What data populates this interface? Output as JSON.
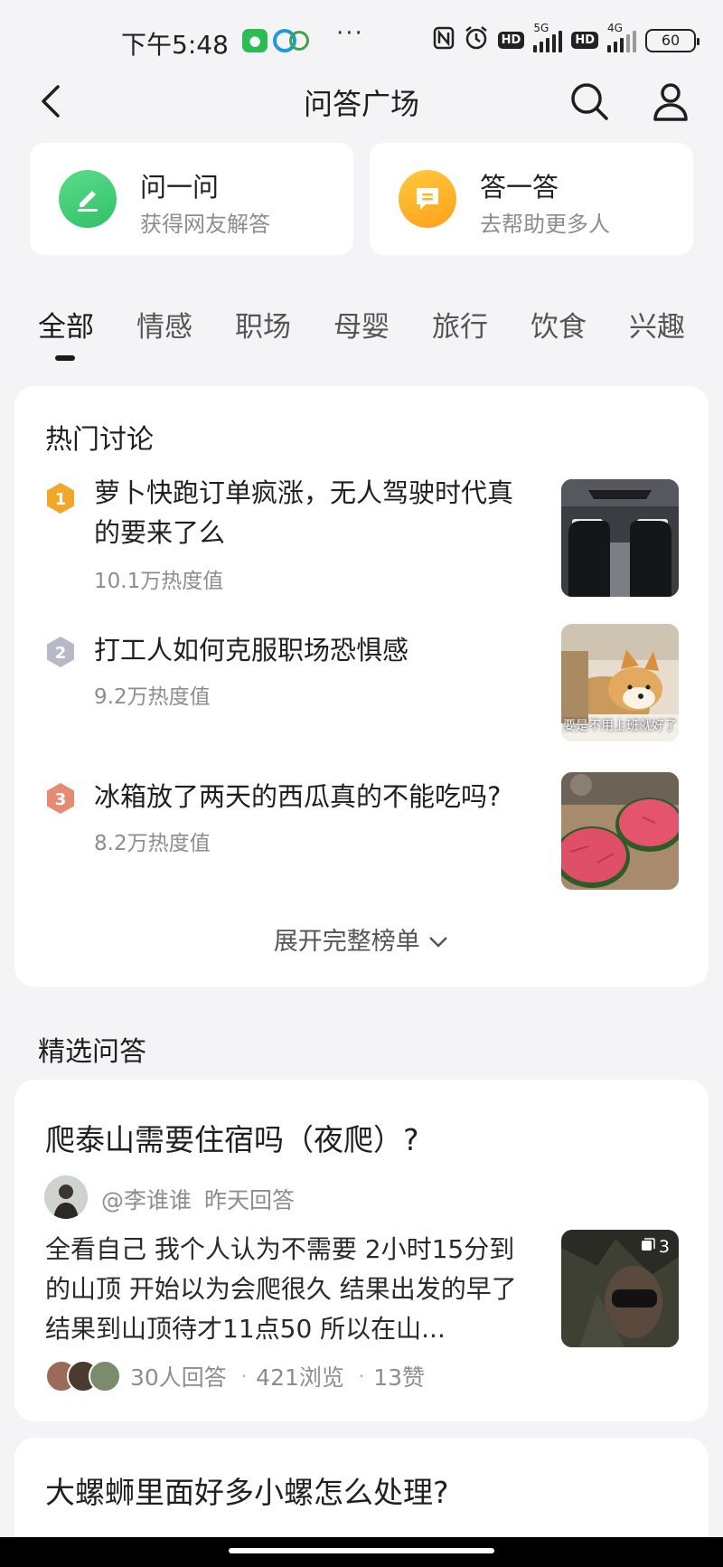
{
  "status_bar": {
    "time": "下午5:48",
    "more": "···",
    "signal_5g": "5G",
    "signal_4g": "4G",
    "hd": "HD",
    "battery": "60"
  },
  "nav": {
    "title": "问答广场",
    "back_icon": "chevron-left-icon",
    "search_icon": "search-icon",
    "user_icon": "user-icon"
  },
  "actions": {
    "ask": {
      "title": "问一问",
      "subtitle": "获得网友解答",
      "color": "#36c56e"
    },
    "answer": {
      "title": "答一答",
      "subtitle": "去帮助更多人",
      "color": "#ffb12a"
    }
  },
  "tabs": [
    "全部",
    "情感",
    "职场",
    "母婴",
    "旅行",
    "饮食",
    "兴趣"
  ],
  "active_tab": "全部",
  "hot": {
    "title": "热门讨论",
    "items": [
      {
        "rank": "1",
        "text": "萝卜快跑订单疯涨，无人驾驶时代真的要来了么",
        "heat": "10.1万热度值",
        "color": "#f0a72a"
      },
      {
        "rank": "2",
        "text": "打工人如何克服职场恐惧感",
        "heat": "9.2万热度值",
        "color": "#b7bac6"
      },
      {
        "rank": "3",
        "text": "冰箱放了两天的西瓜真的不能吃吗?",
        "heat": "8.2万热度值",
        "color": "#e58b73"
      }
    ],
    "thumb2_caption": "要是不用上班就好了",
    "expand": "展开完整榜单"
  },
  "featured": {
    "title": "精选问答",
    "post": {
      "title": "爬泰山需要住宿吗（夜爬）?",
      "author": "@李谁谁",
      "time": "昨天回答",
      "body": "全看自己 我个人认为不需要 2小时15分到的山顶 开始以为会爬很久 结果出发的早了 结果到山顶待才11点50 所以在山...",
      "image_count": "3",
      "answers": "30人回答",
      "views": "421浏览",
      "likes": "13赞"
    },
    "post2": {
      "title": "大螺蛳里面好多小螺怎么处理?"
    }
  }
}
